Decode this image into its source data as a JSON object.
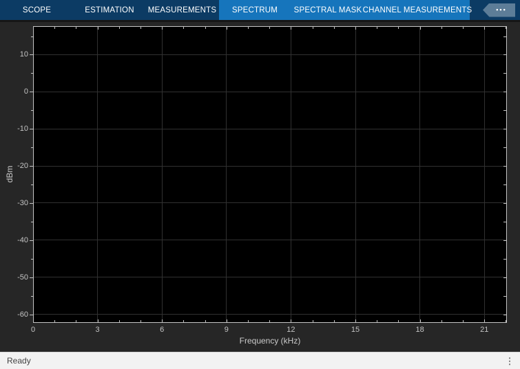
{
  "toolstrip": {
    "tabs": [
      {
        "label": "SCOPE",
        "highlighted": false
      },
      {
        "label": "ESTIMATION",
        "highlighted": false
      },
      {
        "label": "MEASUREMENTS",
        "highlighted": false
      },
      {
        "label": "SPECTRUM",
        "highlighted": true
      },
      {
        "label": "SPECTRAL MASK",
        "highlighted": true
      },
      {
        "label": "CHANNEL MEASUREMENTS",
        "highlighted": true
      }
    ],
    "overflow_button": {
      "icon": "ellipsis-icon",
      "glyph": "•••"
    },
    "colors": {
      "bar_bg": "#0c3b64",
      "highlight_bg": "#1675bc",
      "text": "#ffffff",
      "overflow_bg": "#5d7d98"
    }
  },
  "chart_data": {
    "type": "line",
    "title": "",
    "xlabel": "Frequency (kHz)",
    "ylabel": "dBm",
    "xlim": [
      0,
      22.05
    ],
    "ylim": [
      -62.3,
      17.7
    ],
    "xticks": [
      0,
      3,
      6,
      9,
      12,
      15,
      18,
      21
    ],
    "xminor_step": 1,
    "yticks": [
      10,
      0,
      -10,
      -20,
      -30,
      -40,
      -50,
      -60
    ],
    "yminor_step": 5,
    "grid": true,
    "legend": false,
    "series": [],
    "colors": {
      "panel_bg": "#262626",
      "plot_bg": "#000000",
      "grid": "#313131",
      "axis_box": "#c6c6c6",
      "tick": "#c6c6c6",
      "tick_label": "#c4c4c4",
      "axis_title": "#cbcbcb"
    }
  },
  "statusbar": {
    "text": "Ready",
    "grip_glyph": "⋮"
  }
}
